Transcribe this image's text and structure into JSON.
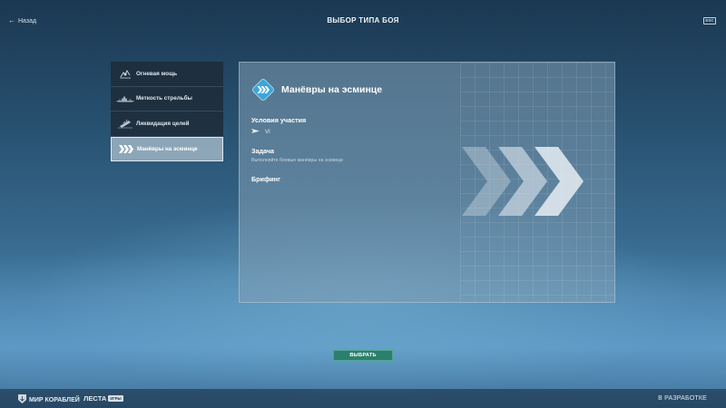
{
  "header": {
    "back_label": "Назад",
    "title": "ВЫБОР ТИПА БОЯ",
    "esc_label": "ESC"
  },
  "sidebar": {
    "items": [
      {
        "label": "Огневая мощь",
        "icon": "firepower-icon",
        "active": false
      },
      {
        "label": "Меткость стрельбы",
        "icon": "ship-silhouette-icon",
        "active": false
      },
      {
        "label": "Ликвидация целей",
        "icon": "sinking-ship-icon",
        "active": false
      },
      {
        "label": "Манёвры на эсминце",
        "icon": "chevrons-icon",
        "active": true
      }
    ]
  },
  "panel": {
    "mode_title": "Манёвры на эсминце",
    "conditions_heading": "Условия участия",
    "tier": "VI",
    "task_heading": "Задача",
    "task_text": "Выполняйте боевые манёвры на эсминце",
    "briefing_heading": "Брифинг"
  },
  "select_button_label": "ВЫБРАТЬ",
  "footer": {
    "game_logo": "МИР КОРАБЛЕЙ",
    "publisher_logo": "ЛЕСТА",
    "publisher_tag": "ИГРЫ",
    "status": "В РАЗРАБОТКЕ"
  },
  "colors": {
    "accent_blue": "#3aa6d8",
    "select_button": "#2c7f6d",
    "active_item": "#96acbe"
  }
}
